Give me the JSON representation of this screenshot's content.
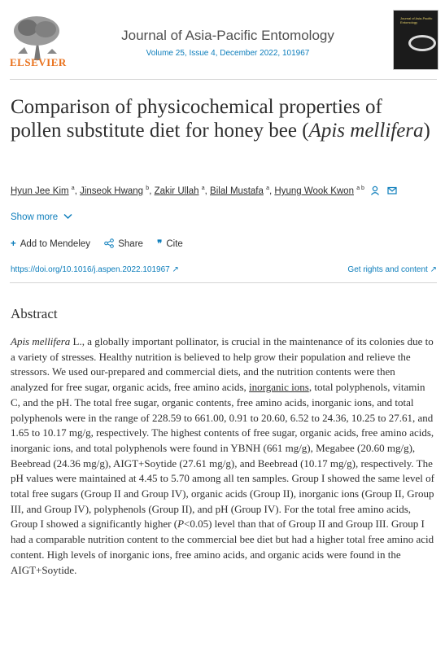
{
  "header": {
    "publisher": "ELSEVIER",
    "journal": "Journal of Asia-Pacific Entomology",
    "volume_info": "Volume 25, Issue 4, December 2022, 101967",
    "cover_text": "Journal of Asia-Pacific Entomology"
  },
  "article": {
    "title_part1": "Comparison of physicochemical properties of pollen substitute diet for honey bee (",
    "title_italic": "Apis mellifera",
    "title_part2": ")",
    "authors": [
      {
        "name": "Hyun Jee Kim",
        "aff": "a"
      },
      {
        "name": "Jinseok Hwang",
        "aff": "b"
      },
      {
        "name": "Zakir Ullah",
        "aff": "a"
      },
      {
        "name": "Bilal Mustafa",
        "aff": "a"
      },
      {
        "name": "Hyung Wook Kwon",
        "aff": "a b"
      }
    ],
    "show_more": "Show more",
    "actions": {
      "mendeley": "Add to Mendeley",
      "share": "Share",
      "cite": "Cite"
    },
    "doi": "https://doi.org/10.1016/j.aspen.2022.101967",
    "rights": "Get rights and content"
  },
  "abstract": {
    "heading": "Abstract",
    "species": "Apis mellifera",
    "text1": " L., a globally important pollinator, is crucial in the maintenance of its colonies due to a variety of stresses. Healthy nutrition is believed to help grow their population and relieve the stressors. We used our-prepared and commercial diets, and the nutrition contents were then analyzed for free sugar, organic acids, free amino acids, ",
    "link": "inorganic ions",
    "text2": ", total polyphenols, vitamin C, and the pH. The total free sugar, organic contents, free amino acids, inorganic ions, and total polyphenols were in the range of 228.59 to 661.00, 0.91 to 20.60, 6.52 to 24.36, 10.25 to 27.61, and 1.65 to 10.17 mg/g, respectively. The highest contents of free sugar, organic acids, free amino acids, inorganic ions, and total polyphenols were found in YBNH (661 mg/g), Megabee (20.60 mg/g), Beebread (24.36 mg/g), AIGT+Soytide (27.61 mg/g), and Beebread (10.17 mg/g), respectively. The pH values were maintained at 4.45 to 5.70 among all ten samples. Group I showed the same level of total free sugars (Group II and Group IV), organic acids (Group II), inorganic ions (Group II, Group III, and Group IV), polyphenols (Group II), and pH (Group IV). For the total free amino acids, Group I showed a significantly higher (",
    "p": "P",
    "text3": "<0.05) level than that of Group II and Group III. Group I had a comparable nutrition content to the commercial bee diet but had a higher total free amino acid content. High levels of inorganic ions, free amino acids, and organic acids were found in the AIGT+Soytide."
  }
}
